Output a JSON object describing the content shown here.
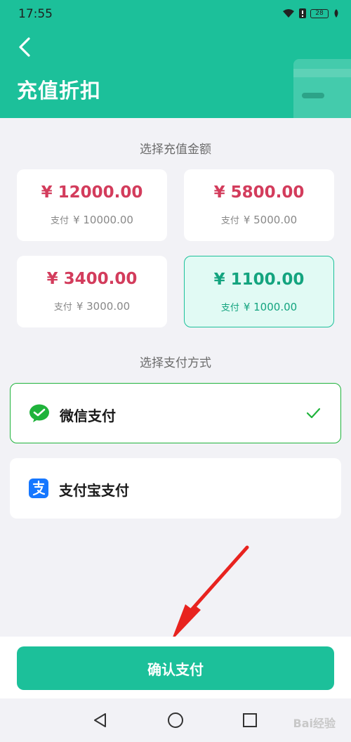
{
  "status_bar": {
    "time": "17:55",
    "battery": "28"
  },
  "header": {
    "title": "充值折扣"
  },
  "amount_section": {
    "title": "选择充值金额",
    "pay_prefix": "支付",
    "options": [
      {
        "value": "¥ 12000.00",
        "pay": "¥ 10000.00",
        "selected": false
      },
      {
        "value": "¥ 5800.00",
        "pay": "¥ 5000.00",
        "selected": false
      },
      {
        "value": "¥ 3400.00",
        "pay": "¥ 3000.00",
        "selected": false
      },
      {
        "value": "¥ 1100.00",
        "pay": "¥ 1000.00",
        "selected": true
      }
    ]
  },
  "payment_section": {
    "title": "选择支付方式",
    "methods": [
      {
        "label": "微信支付",
        "icon": "wechat-pay-icon",
        "selected": true
      },
      {
        "label": "支付宝支付",
        "icon": "alipay-icon",
        "selected": false
      }
    ]
  },
  "confirm_button": {
    "label": "确认支付"
  },
  "watermark": {
    "text": "Bai经验"
  },
  "colors": {
    "accent": "#1cc09a",
    "price": "#d33c5c",
    "selected_border": "#1fb33b",
    "arrow": "#e8231f"
  }
}
